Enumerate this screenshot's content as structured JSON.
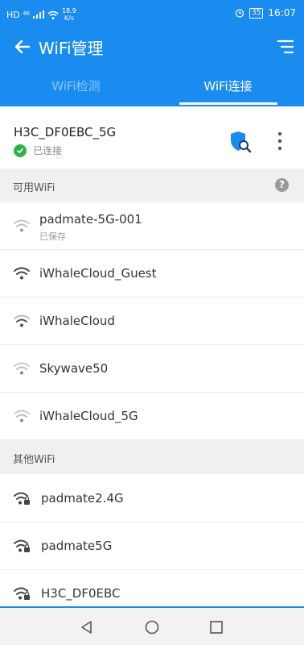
{
  "status_bar": {
    "network": "HD ⁴⁶",
    "speed_top": "18.9",
    "speed_bottom": "K/s",
    "battery": "35",
    "time": "16:07"
  },
  "header": {
    "title": "WiFi管理"
  },
  "tabs": [
    {
      "label": "WiFi检测",
      "active": false
    },
    {
      "label": "WiFi连接",
      "active": true
    }
  ],
  "current": {
    "ssid": "H3C_DF0EBC_5G",
    "status": "已连接"
  },
  "available": {
    "label": "可用WiFi",
    "items": [
      {
        "name": "padmate-5G-001",
        "sub": "已保存"
      },
      {
        "name": "iWhaleCloud_Guest"
      },
      {
        "name": "iWhaleCloud"
      },
      {
        "name": "Skywave50"
      },
      {
        "name": "iWhaleCloud_5G"
      }
    ]
  },
  "other": {
    "label": "其他WiFi",
    "items": [
      {
        "name": "padmate2.4G"
      },
      {
        "name": "padmate5G"
      },
      {
        "name": "H3C_DF0EBC"
      }
    ]
  },
  "icons": {
    "back": "arrow-left-icon",
    "menu": "menu-icon",
    "shield": "shield-search-icon",
    "more": "more-vertical-icon",
    "help": "help-icon",
    "wifi": "wifi-icon",
    "wifi_locked": "wifi-lock-icon"
  },
  "colors": {
    "primary": "#1a8cf0",
    "success": "#2bb24c"
  }
}
